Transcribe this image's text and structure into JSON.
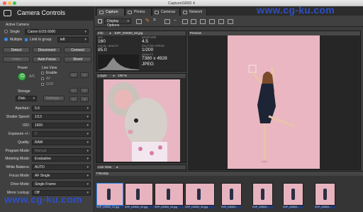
{
  "window": {
    "title": "CaptureGRID 4"
  },
  "panel": {
    "title": "Camera Controls"
  },
  "active_camera": {
    "heading": "Active Camera",
    "single_label": "Single",
    "camera_value": "Canon EOS 6000",
    "multiple_label": "Multiple",
    "limit_label": "Limit to group:",
    "group_value": "left"
  },
  "connection_buttons": [
    "Detect",
    "Disconnect",
    "Connect"
  ],
  "mode_buttons": [
    "Video",
    "Auto Focus",
    "Shoot"
  ],
  "power": {
    "label": "Power",
    "ac_label": "A/C"
  },
  "live_view": {
    "label": "Live View",
    "enable_label": "Enable",
    "af_label": "AF",
    "dof_label": "DOF"
  },
  "storage": {
    "label": "Storage",
    "value": "Disk",
    "settings_label": "Settings..."
  },
  "settings": [
    {
      "label": "Aperture:",
      "value": "5.6",
      "disabled": false
    },
    {
      "label": "Shutter Speed:",
      "value": "1/13",
      "disabled": false
    },
    {
      "label": "ISO:",
      "value": "1600",
      "disabled": false
    },
    {
      "label": "Exposure +/-:",
      "value": "0",
      "disabled": true
    },
    {
      "label": "Quality:",
      "value": "RAW",
      "disabled": false
    },
    {
      "label": "Program Mode:",
      "value": "Manual",
      "disabled": true
    },
    {
      "label": "Metering Mode:",
      "value": "Evaluative",
      "disabled": false
    },
    {
      "label": "White Balance:",
      "value": "AUTO",
      "disabled": false
    },
    {
      "label": "Focus Mode:",
      "value": "AF Single",
      "disabled": false
    },
    {
      "label": "Drive Mode:",
      "value": "Single Frame",
      "disabled": false
    },
    {
      "label": "Mirror Lockup:",
      "value": "Off",
      "disabled": false
    }
  ],
  "tabs": [
    {
      "label": "Capture",
      "active": true
    },
    {
      "label": "Photos",
      "active": false
    },
    {
      "label": "Cameras",
      "active": false
    },
    {
      "label": "Network",
      "active": false
    }
  ],
  "toolbar": {
    "display_options_label": "Display Options"
  },
  "info_panel": {
    "header": "Info",
    "filename": "SSP_DS500_53.jpg",
    "iso_value": "160",
    "iso_key": "ISO",
    "focal_value": "85.0",
    "focal_key": "FOCAL LENGTH",
    "aperture_value": "4.5",
    "aperture_key": "APERTURE",
    "shutter_value": "1/200",
    "shutter_key": "SHUTTER SPEED",
    "dims_value": "7380 x 4928",
    "quality_key": "QUALITY",
    "format_value": "JPEG"
  },
  "loupe": {
    "header": "Loupe",
    "zoom": "100 %"
  },
  "live_view_panel": {
    "header": "Live View"
  },
  "preview": {
    "header": "Preview"
  },
  "filmstrip": {
    "header": "Filmstrip",
    "thumbs": [
      "SSP_DS500_31.jpg",
      "SSP_DS500_32.jpg",
      "SSP_DS500_33.jpg",
      "SSP_DS500_34.jpg",
      "SSP_DS500...",
      "SSP_DS500...",
      "SSP_DS500...",
      "SSP_DS500..."
    ]
  },
  "watermarks": [
    "www.cg-ku.com",
    "www.cg-ku.com"
  ],
  "colors": {
    "accent": "#2f8cf0",
    "pink_backdrop": "#e9b6c1",
    "watermark": "#2d4fc8"
  }
}
